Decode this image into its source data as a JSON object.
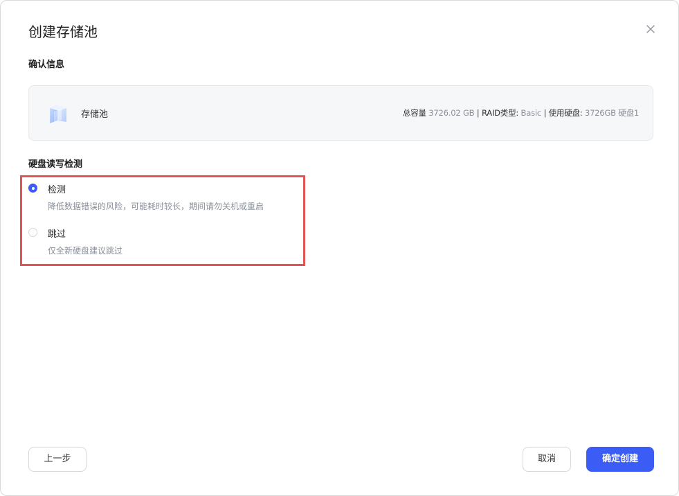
{
  "dialog": {
    "title": "创建存储池",
    "close_icon": "close-icon"
  },
  "confirm": {
    "label": "确认信息",
    "pool": {
      "icon": "storage-pool-icon",
      "name": "存储池",
      "capacity_label": "总容量",
      "capacity_value": "3726.02 GB",
      "sep1": "|",
      "raid_label": "RAID类型:",
      "raid_value": "Basic",
      "sep2": "|",
      "disk_label": "使用硬盘:",
      "disk_value": "3726GB 硬盘1"
    }
  },
  "disk_check": {
    "label": "硬盘读写检测",
    "options": [
      {
        "title": "检测",
        "desc": "降低数据错误的风险，可能耗时较长，期间请勿关机或重启",
        "selected": true
      },
      {
        "title": "跳过",
        "desc": "仅全新硬盘建议跳过",
        "selected": false
      }
    ]
  },
  "footer": {
    "prev_label": "上一步",
    "cancel_label": "取消",
    "confirm_label": "确定创建"
  },
  "colors": {
    "primary": "#3b5cf5",
    "highlight_border": "#e05454"
  }
}
